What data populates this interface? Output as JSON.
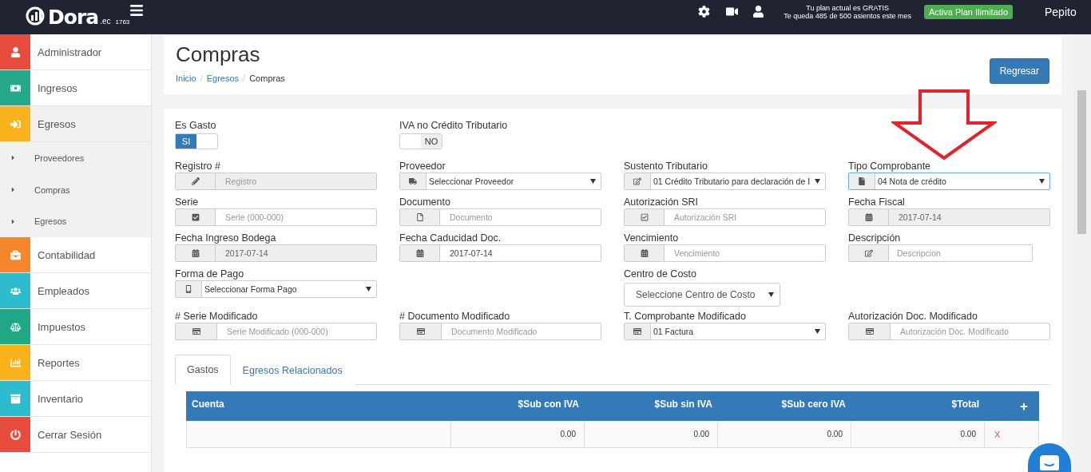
{
  "topbar": {
    "logo": "Dora",
    "logo_suffix": ".ec",
    "version": "1763",
    "plan_line_1": "Tu plan actual es GRATIS",
    "plan_line_2": "Te queda 485 de 500 asientos este mes",
    "upgrade_button": "Activa Plan Ilimitado",
    "user": "Pepito"
  },
  "sidebar": {
    "items": [
      {
        "label": "Administrador",
        "color": "#e74c3c",
        "selected": false
      },
      {
        "label": "Ingresos",
        "color": "#26a98b",
        "selected": false
      },
      {
        "label": "Egresos",
        "color": "#f9b21c",
        "selected": true,
        "expanded": true,
        "children": [
          {
            "label": "Proveedores"
          },
          {
            "label": "Compras"
          },
          {
            "label": "Egresos"
          }
        ]
      },
      {
        "label": "Contabilidad",
        "color": "#f6862c",
        "selected": false
      },
      {
        "label": "Empleados",
        "color": "#2cbccd",
        "selected": false
      },
      {
        "label": "Impuestos",
        "color": "#1fa886",
        "selected": false
      },
      {
        "label": "Reportes",
        "color": "#f9b21c",
        "selected": false
      },
      {
        "label": "Inventario",
        "color": "#2cbccd",
        "selected": false
      },
      {
        "label": "Cerrar Sesión",
        "color": "#e74c3c",
        "selected": false
      }
    ]
  },
  "page": {
    "title": "Compras",
    "breadcrumb": [
      "Inicio",
      "Egresos",
      "Compras"
    ],
    "breadcrumb_separator": "/",
    "back_button": "Regresar"
  },
  "form": {
    "rows": [
      [
        {
          "kind": "toggle",
          "label": "Es Gasto",
          "value": "SI",
          "on": true
        },
        {
          "kind": "toggle",
          "label": "IVA no Crédito Tributario",
          "value": "NO",
          "on": false
        },
        null,
        null
      ],
      [
        {
          "kind": "input",
          "label": "Registro #",
          "placeholder": "Registro",
          "disabled": true
        },
        {
          "kind": "select",
          "label": "Proveedor",
          "value": "Seleccionar Proveedor",
          "focused": false
        },
        {
          "kind": "select",
          "label": "Sustento Tributario",
          "value": "01 Crédito Tributario para declaración de I",
          "focused": false
        },
        {
          "kind": "select",
          "label": "Tipo Comprobante",
          "value": "04 Nota de crédito",
          "focused": true
        }
      ],
      [
        {
          "kind": "input",
          "label": "Serie",
          "placeholder": "Serie (000-000)",
          "disabled": false
        },
        {
          "kind": "input",
          "label": "Documento",
          "placeholder": "Documento",
          "disabled": false
        },
        {
          "kind": "input",
          "label": "Autorización SRI",
          "placeholder": "Autorización SRI",
          "disabled": false
        },
        {
          "kind": "input",
          "label": "Fecha Fiscal",
          "value": "2017-07-14",
          "disabled": true
        }
      ],
      [
        {
          "kind": "input",
          "label": "Fecha Ingreso Bodega",
          "value": "2017-07-14",
          "disabled": true
        },
        {
          "kind": "input",
          "label": "Fecha Caducidad Doc.",
          "value": "2017-07-14",
          "disabled": false
        },
        {
          "kind": "input",
          "label": "Vencimiento",
          "placeholder": "Vencimiento",
          "disabled": false
        },
        {
          "kind": "input",
          "label": "Descripción",
          "placeholder": "Descripcion",
          "disabled": false
        }
      ],
      [
        {
          "kind": "select",
          "label": "Forma de Pago",
          "value": "Seleccionar Forma Pago",
          "focused": false
        },
        null,
        {
          "kind": "plain-select",
          "label": "Centro de Costo",
          "value": "Seleccione Centro de Costo"
        },
        null
      ],
      [
        {
          "kind": "input",
          "label": "# Serie Modificado",
          "placeholder": "Serie Modificado (000-000)",
          "disabled": false
        },
        {
          "kind": "input",
          "label": "# Documento Modificado",
          "placeholder": "Documento Modificado",
          "disabled": false
        },
        {
          "kind": "select",
          "label": "T. Comprobante Modificado",
          "value": "01 Factura",
          "focused": false
        },
        {
          "kind": "input",
          "label": "Autorización Doc. Modificado",
          "placeholder": "Autorización Doc. Modificado",
          "disabled": false
        }
      ]
    ]
  },
  "tabs": [
    {
      "label": "Gastos",
      "selected": true
    },
    {
      "label": "Egresos Relacionados",
      "selected": false
    }
  ],
  "table": {
    "columns": [
      "Cuenta",
      "$Sub con IVA",
      "$Sub sin IVA",
      "$Sub cero IVA",
      "$Total"
    ],
    "rows": [
      {
        "cells": [
          "",
          "0.00",
          "0.00",
          "0.00",
          "0.00"
        ],
        "delete": "X"
      }
    ]
  }
}
